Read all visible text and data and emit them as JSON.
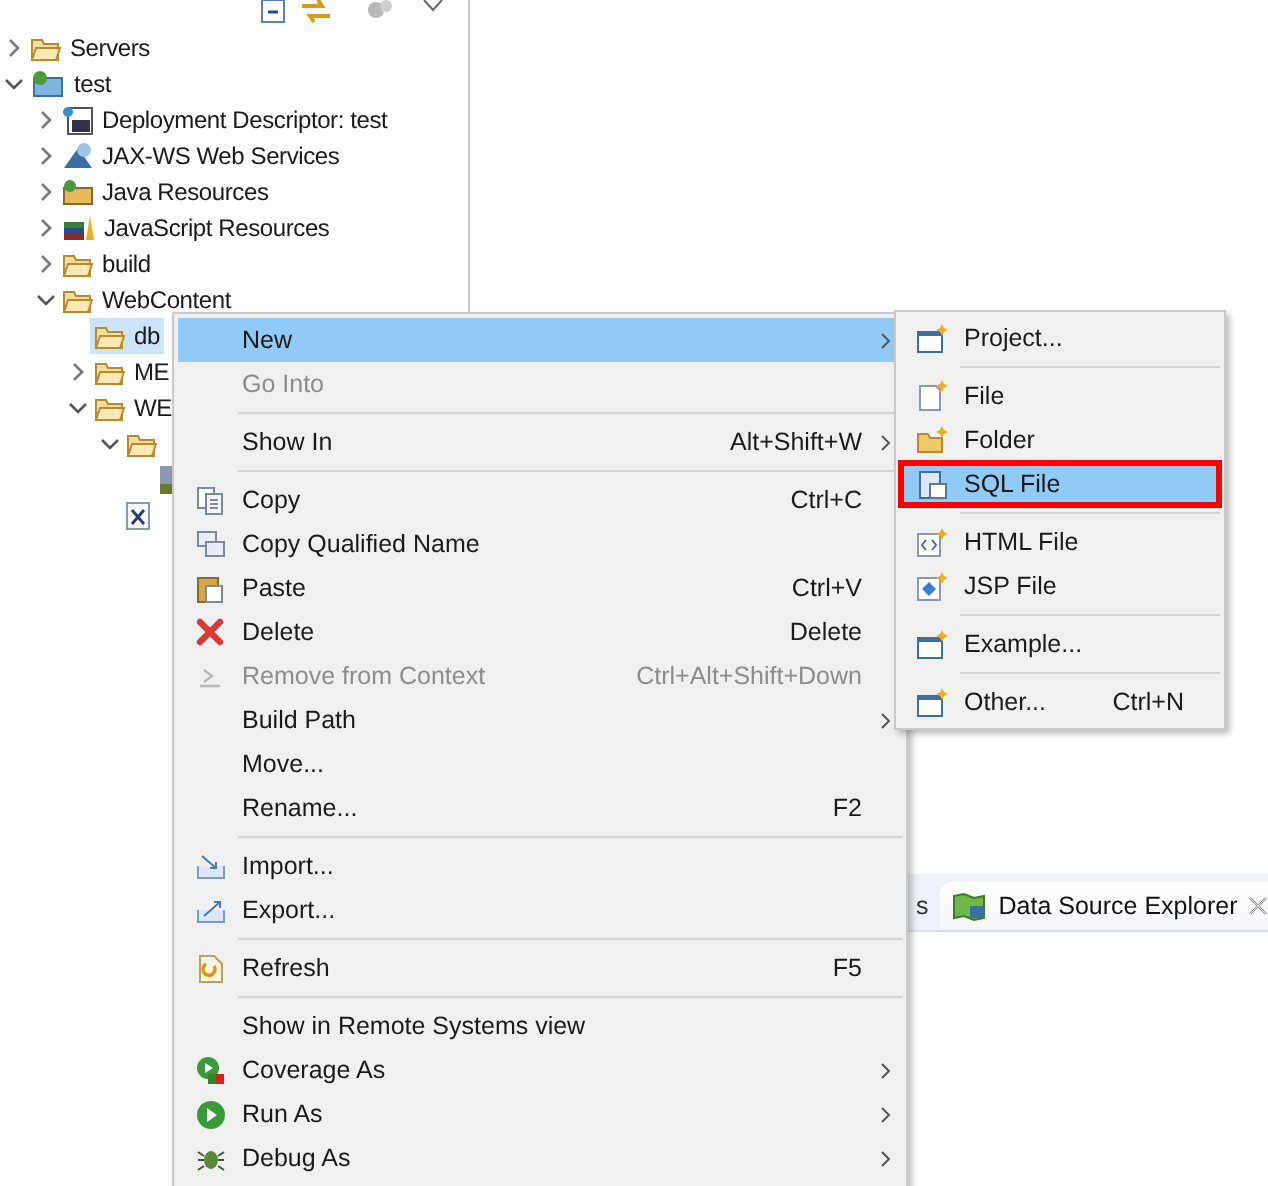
{
  "tree": [
    {
      "label": "Servers",
      "kind": "folder",
      "expanded": false,
      "selected": false
    },
    {
      "label": "test",
      "kind": "project",
      "expanded": true,
      "selected": false,
      "children": [
        {
          "label": "Deployment Descriptor: test",
          "kind": "descriptor",
          "expanded": false,
          "selected": false
        },
        {
          "label": "JAX-WS Web Services",
          "kind": "webservice",
          "expanded": false,
          "selected": false
        },
        {
          "label": "Java Resources",
          "kind": "javares",
          "expanded": false,
          "selected": false
        },
        {
          "label": "JavaScript Resources",
          "kind": "jsres",
          "expanded": false,
          "selected": false
        },
        {
          "label": "build",
          "kind": "folder",
          "expanded": false,
          "selected": false
        },
        {
          "label": "WebContent",
          "kind": "folder",
          "expanded": true,
          "selected": false,
          "children": [
            {
              "label": "db",
              "kind": "folder",
              "selected": true
            },
            {
              "label": "ME",
              "kind": "folder",
              "expanded": false,
              "selected": false
            },
            {
              "label": "WE",
              "kind": "folder",
              "expanded": true,
              "selected": false,
              "children": [
                {
                  "kind": "folder",
                  "expanded": true,
                  "selected": false,
                  "children": [
                    {
                      "kind": "lib",
                      "selected": false
                    }
                  ]
                },
                {
                  "kind": "xml",
                  "selected": false
                }
              ]
            }
          ]
        }
      ]
    }
  ],
  "menu": [
    {
      "kind": "plain",
      "label": "New",
      "submenu": true,
      "disabled": false,
      "selected": true
    },
    {
      "kind": "plain",
      "label": "Go Into",
      "submenu": false,
      "disabled": true,
      "selected": false
    },
    {
      "kind": "separator"
    },
    {
      "kind": "plain",
      "label": "Show In",
      "shortcut": "Alt+Shift+W",
      "submenu": true,
      "disabled": false,
      "selected": false
    },
    {
      "kind": "separator"
    },
    {
      "kind": "copy",
      "label": "Copy",
      "shortcut": "Ctrl+C",
      "submenu": false,
      "disabled": false,
      "selected": false
    },
    {
      "kind": "copyq",
      "label": "Copy Qualified Name",
      "submenu": false,
      "disabled": false,
      "selected": false
    },
    {
      "kind": "paste",
      "label": "Paste",
      "shortcut": "Ctrl+V",
      "submenu": false,
      "disabled": false,
      "selected": false
    },
    {
      "kind": "delete",
      "label": "Delete",
      "shortcut": "Delete",
      "submenu": false,
      "disabled": false,
      "selected": false
    },
    {
      "kind": "remove",
      "label": "Remove from Context",
      "shortcut": "Ctrl+Alt+Shift+Down",
      "submenu": false,
      "disabled": true,
      "selected": false
    },
    {
      "kind": "plain",
      "label": "Build Path",
      "submenu": true,
      "disabled": false,
      "selected": false
    },
    {
      "kind": "plain",
      "label": "Move...",
      "submenu": false,
      "disabled": false,
      "selected": false
    },
    {
      "kind": "plain",
      "label": "Rename...",
      "shortcut": "F2",
      "submenu": false,
      "disabled": false,
      "selected": false
    },
    {
      "kind": "separator"
    },
    {
      "kind": "import",
      "label": "Import...",
      "submenu": false,
      "disabled": false,
      "selected": false
    },
    {
      "kind": "export",
      "label": "Export...",
      "submenu": false,
      "disabled": false,
      "selected": false
    },
    {
      "kind": "separator"
    },
    {
      "kind": "refresh",
      "label": "Refresh",
      "shortcut": "F5",
      "submenu": false,
      "disabled": false,
      "selected": false
    },
    {
      "kind": "separator"
    },
    {
      "kind": "plain",
      "label": "Show in Remote Systems view",
      "submenu": false,
      "disabled": false,
      "selected": false
    },
    {
      "kind": "coverage",
      "label": "Coverage As",
      "submenu": true,
      "disabled": false,
      "selected": false
    },
    {
      "kind": "run",
      "label": "Run As",
      "submenu": true,
      "disabled": false,
      "selected": false
    },
    {
      "kind": "debug",
      "label": "Debug As",
      "submenu": true,
      "disabled": false,
      "selected": false
    }
  ],
  "submenu": [
    {
      "kind": "wizard",
      "label": "Project...",
      "selected": false,
      "outlined": false
    },
    {
      "kind": "separator"
    },
    {
      "kind": "file",
      "label": "File",
      "selected": false,
      "outlined": false
    },
    {
      "kind": "folder",
      "label": "Folder",
      "selected": false,
      "outlined": false
    },
    {
      "kind": "sql",
      "label": "SQL File",
      "selected": true,
      "outlined": true
    },
    {
      "kind": "separator"
    },
    {
      "kind": "html",
      "label": "HTML File",
      "selected": false,
      "outlined": false
    },
    {
      "kind": "jsp",
      "label": "JSP File",
      "selected": false,
      "outlined": false
    },
    {
      "kind": "separator"
    },
    {
      "kind": "wizard",
      "label": "Example...",
      "selected": false,
      "outlined": false
    },
    {
      "kind": "separator"
    },
    {
      "kind": "wizard",
      "label": "Other...",
      "shortcut": "Ctrl+N",
      "selected": false,
      "outlined": false
    }
  ],
  "bottom_tabs": [
    {
      "label": "s",
      "selected": false,
      "closable": false
    },
    {
      "label": "Data Source Explorer",
      "selected": true,
      "closable": true
    }
  ]
}
